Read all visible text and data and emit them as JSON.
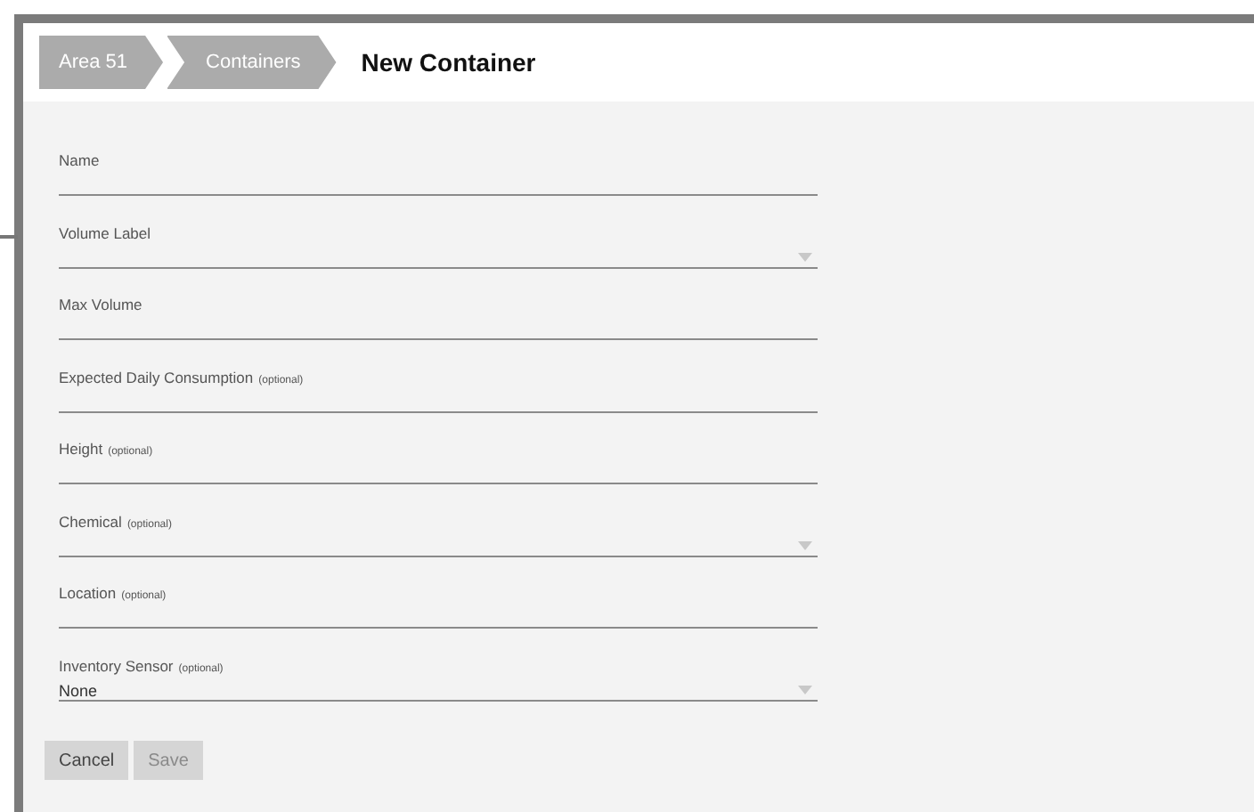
{
  "breadcrumbs": [
    {
      "label": "Area 51"
    },
    {
      "label": "Containers"
    }
  ],
  "title": "New Container",
  "fields": [
    {
      "kind": "text",
      "label": "Name"
    },
    {
      "kind": "select",
      "label": "Volume Label"
    },
    {
      "kind": "text",
      "label": "Max Volume"
    },
    {
      "kind": "text",
      "label": "Expected Daily Consumption",
      "note": "(optional)"
    },
    {
      "kind": "text",
      "label": "Height",
      "note": "(optional)"
    },
    {
      "kind": "select",
      "label": "Chemical",
      "note": "(optional)"
    },
    {
      "kind": "text",
      "label": "Location",
      "note": "(optional)"
    },
    {
      "kind": "select",
      "label": "Inventory Sensor",
      "note": "(optional)",
      "value": "None"
    }
  ],
  "buttons": [
    {
      "label": "Cancel",
      "disabled": false
    },
    {
      "label": "Save",
      "disabled": true
    }
  ]
}
